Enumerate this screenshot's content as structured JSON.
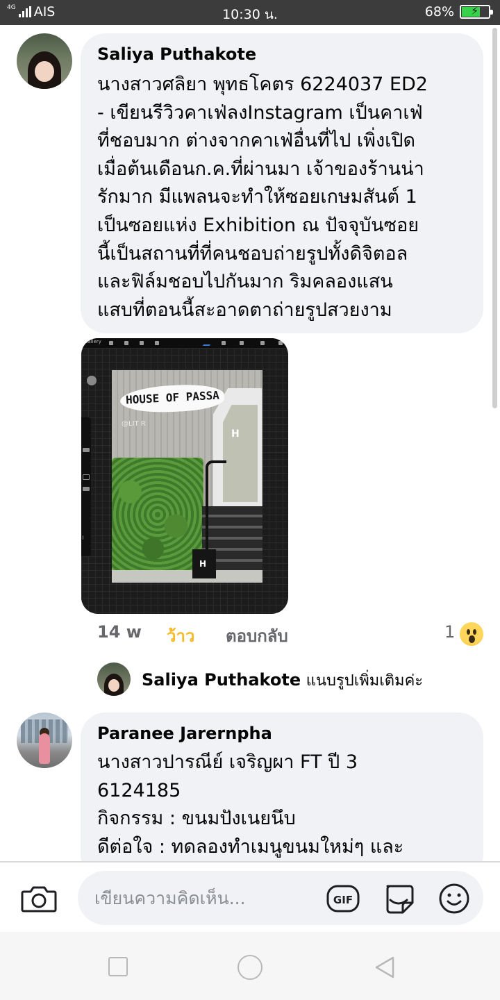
{
  "status_bar": {
    "network": "4G",
    "carrier": "AIS",
    "time": "10:30 น.",
    "battery_percent": "68%",
    "battery_level": 0.68,
    "battery_color": "#37d14a"
  },
  "comments": [
    {
      "author": "Saliya Puthakote",
      "text": "นางสาวศลิยา พุทธโคตร 6224037 ED2\n- เขียนรีวิวคาเฟ่ลงInstagram เป็นคาเฟ่\nที่ชอบมาก ต่างจากคาเฟ่อื่นที่ไป เพิ่งเปิด\nเมื่อต้นเดือนก.ค.ที่ผ่านมา เจ้าของร้านน่า\nรักมาก มีแพลนจะทำให้ซอยเกษมสันต์ 1\nเป็นซอยแห่ง Exhibition ณ ปัจจุบันซอย\nนี้เป็นสถานที่ที่คนชอบถ่ายรูปทั้งดิจิตอล\nและฟิล์มชอบไปกันมาก ริมคลองแสน\nแสบที่ตอนนี้สะอาดตาถ่ายรูปสวยงาม",
      "photo": {
        "app_label": "Gallery",
        "sign_text": "HOUSE OF PASSA",
        "watermark": "@LIT R",
        "logo_mark": "H"
      },
      "time_ago": "14 w",
      "like_label": "ว้าว",
      "reply_label": "ตอบกลับ",
      "reaction_count": "1",
      "reaction_icon": "wow-emoji-icon",
      "reply_preview": {
        "author": "Saliya Puthakote",
        "text": "แนบรูปเพิ่มเติมค่ะ"
      }
    },
    {
      "author": "Paranee Jarernpha",
      "text": "นางสาวปารณีย์ เจริญผา FT ปี 3\n6124185\nกิจกรรม : ขนมปังเนยนึบ\nดีต่อใจ : ทดลองทำเมนูขนมใหม่ๆ และ"
    }
  ],
  "composer": {
    "placeholder": "เขียนความคิดเห็น...",
    "gif_label": "GIF",
    "icons": [
      "camera-icon",
      "gif-icon",
      "sticker-icon",
      "emoji-icon"
    ]
  },
  "nav_bar": {
    "icons": [
      "recent-apps-icon",
      "home-icon",
      "back-icon"
    ]
  },
  "colors": {
    "bubble": "#f0f2f5",
    "like_active": "#f7b928",
    "meta_text": "#65676b",
    "status_bar": "#3c3c3c"
  }
}
